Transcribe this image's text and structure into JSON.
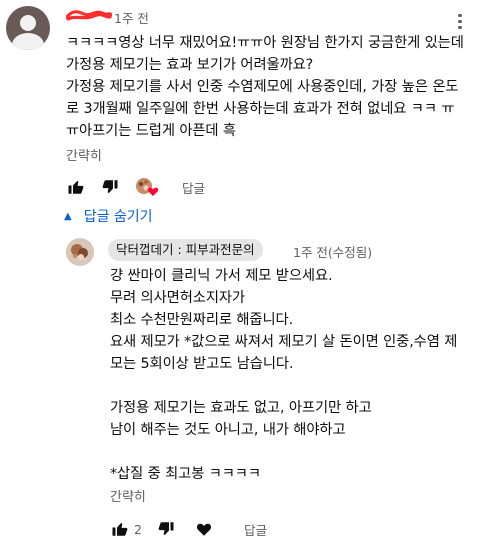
{
  "comment": {
    "time": "1주 전",
    "text": "ㅋㅋㅋㅋ영상 너무 재밌어요!ㅠㅠ아 원장님 한가지 궁금한게 있는데 가정용 제모기는 효과 보기가 어려울까요?\n가정용 제모기를 사서 인중 수염제모에 사용중인데, 가장 높은 온도로 3개월째 일주일에 한번 사용하는데 효과가 전혀 없네요 ㅋㅋ ㅠㅠ아프기는 드럽게 아픈데 흑",
    "read_more": "간략히",
    "reply_label": "답글",
    "icons": [
      "thumbs-up-icon",
      "thumbs-down-icon",
      "creator-heart-icon",
      "more-vert-icon"
    ]
  },
  "replies_toggle": {
    "label": "답글 숨기기",
    "icon": "caret-up-icon",
    "color": "#065fd4"
  },
  "reply": {
    "author": "닥터껍데기 : 피부과전문의",
    "time": "1주 전(수정됨)",
    "text": "걍 싼마이 클리닉 가서 제모 받으세요.\n무려 의사면허소지자가\n최소 수천만원짜리로 해줍니다.\n요새 제모가 *값으로 싸져서 제모기 살 돈이면 인중,수염 제모는 5회이상 받고도 남습니다.\n\n가정용 제모기는 효과도 없고, 아프기만 하고\n남이 해주는 것도 아니고, 내가 해야하고\n\n*삽질 중 최고봉 ㅋㅋㅋㅋ",
    "read_more": "간략히",
    "like_count": "2",
    "reply_label": "답글",
    "icons": [
      "thumbs-up-icon",
      "thumbs-down-icon",
      "heart-icon"
    ]
  }
}
